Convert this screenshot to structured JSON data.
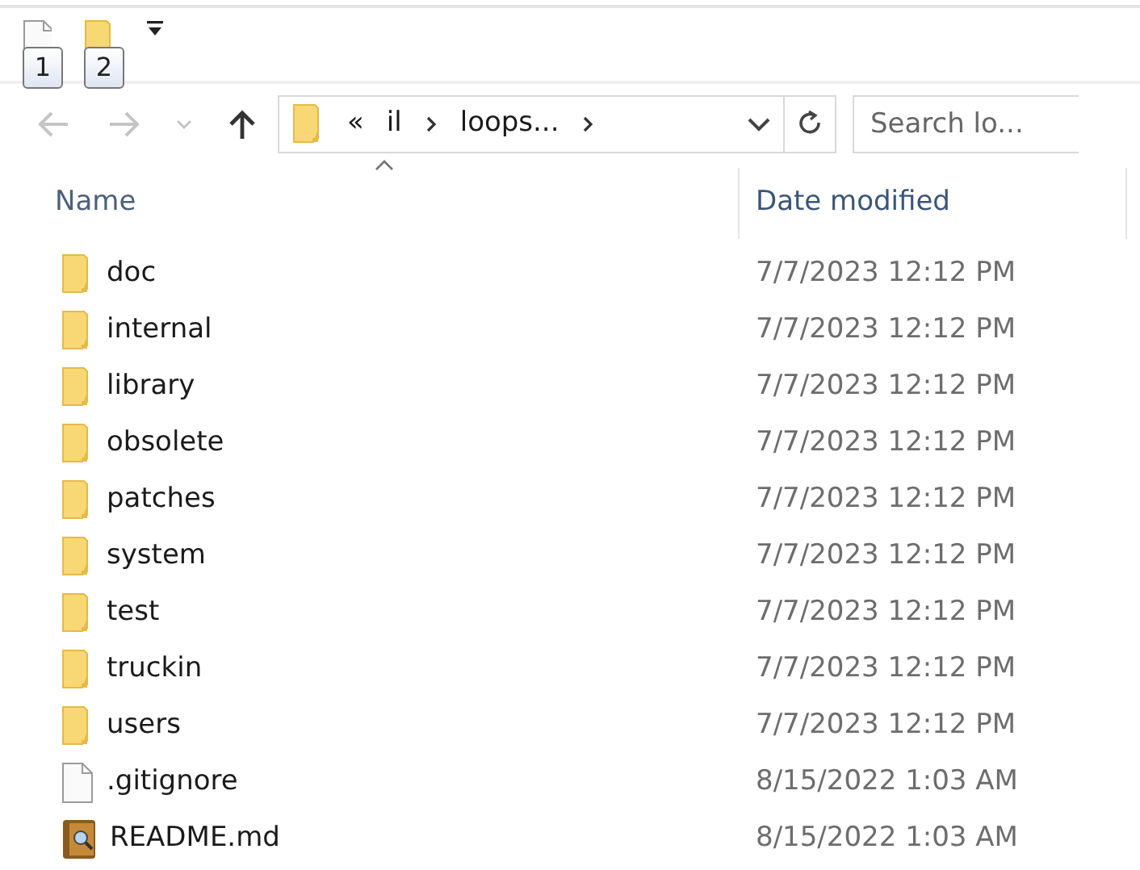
{
  "quick_access": [
    {
      "kind": "file",
      "keytip": "1"
    },
    {
      "kind": "folder",
      "keytip": "2"
    }
  ],
  "navigation": {
    "back": {
      "disabled": true
    },
    "forward": {
      "disabled": true
    },
    "recent": {
      "disabled": true
    },
    "up": {
      "disabled": false
    }
  },
  "address_bar": {
    "overflow": "«",
    "crumbs": [
      "il",
      "loops..."
    ]
  },
  "search": {
    "placeholder": "Search lo..."
  },
  "columns": [
    {
      "label": "Name",
      "sorted": true,
      "hovered": false
    },
    {
      "label": "Date modified",
      "sorted": false,
      "hovered": true
    }
  ],
  "rows": [
    {
      "kind": "folder",
      "name": "doc",
      "date": "7/7/2023 12:12 PM"
    },
    {
      "kind": "folder",
      "name": "internal",
      "date": "7/7/2023 12:12 PM"
    },
    {
      "kind": "folder",
      "name": "library",
      "date": "7/7/2023 12:12 PM"
    },
    {
      "kind": "folder",
      "name": "obsolete",
      "date": "7/7/2023 12:12 PM"
    },
    {
      "kind": "folder",
      "name": "patches",
      "date": "7/7/2023 12:12 PM"
    },
    {
      "kind": "folder",
      "name": "system",
      "date": "7/7/2023 12:12 PM"
    },
    {
      "kind": "folder",
      "name": "test",
      "date": "7/7/2023 12:12 PM"
    },
    {
      "kind": "folder",
      "name": "truckin",
      "date": "7/7/2023 12:12 PM"
    },
    {
      "kind": "folder",
      "name": "users",
      "date": "7/7/2023 12:12 PM"
    },
    {
      "kind": "file",
      "name": ".gitignore",
      "date": "8/15/2022 1:03 AM"
    },
    {
      "kind": "book",
      "name": "README.md",
      "date": "8/15/2022 1:03 AM"
    }
  ]
}
